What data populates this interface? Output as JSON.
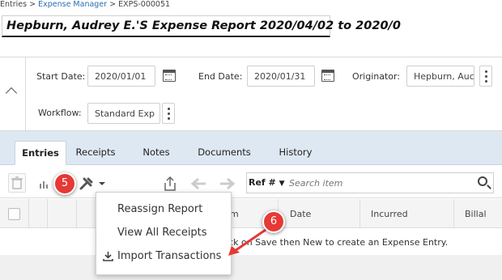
{
  "breadcrumb": {
    "root": "Entries",
    "sep1": " > ",
    "link": "Expense Manager",
    "sep2": " > ",
    "current": "EXPS-000051"
  },
  "report_title": "Hepburn, Audrey E.'S Expense Report 2020/04/02 to 2020/0",
  "filters": {
    "start_date_label": "Start Date:",
    "start_date_value": "2020/01/01",
    "end_date_label": "End Date:",
    "end_date_value": "2020/01/31",
    "originator_label": "Originator:",
    "originator_value": "Hepburn, Auc",
    "workflow_label": "Workflow:",
    "workflow_value": "Standard Exp"
  },
  "tabs": [
    "Entries",
    "Receipts",
    "Notes",
    "Documents",
    "History"
  ],
  "search": {
    "selector_label": "Ref #",
    "placeholder": "Search item"
  },
  "grid": {
    "columns": [
      "m",
      "Date",
      "Incurred",
      "Billal"
    ],
    "empty_message": "ick on Save then New to create an Expense Entry."
  },
  "menu": {
    "items": [
      "Reassign Report",
      "View All Receipts",
      "Import Transactions"
    ]
  },
  "callouts": [
    "5",
    "6"
  ],
  "colors": {
    "accent_blue": "#2a6fb0",
    "tab_bar": "#dde8f2",
    "callout_red": "#e53935"
  }
}
